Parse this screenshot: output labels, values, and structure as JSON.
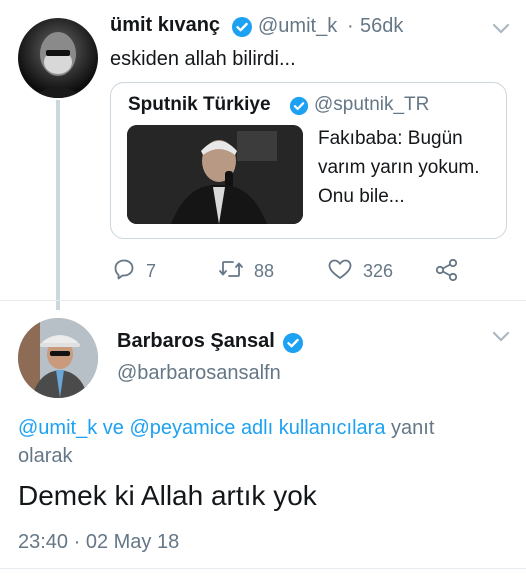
{
  "tweet": {
    "author_name": "ümit kıvanç",
    "author_handle": "@umit_k",
    "separator": "·",
    "time_ago": "56dk",
    "text": "eskiden allah bilirdi...",
    "quoted": {
      "author_name": "Sputnik Türkiye",
      "author_handle": "@sputnik_TR",
      "text": "Fakıbaba: Bugün varım yarın yokum. Onu bile..."
    },
    "actions": {
      "replies": "7",
      "retweets": "88",
      "likes": "326"
    }
  },
  "reply": {
    "author_name": "Barbaros Şansal",
    "author_handle": "@barbarosansalfn",
    "reply_to": {
      "mention1": "@umit_k",
      "connector": "ve",
      "mention2": "@peyamice",
      "mid_text": "adlı kullanıcılara",
      "tail_text": "yanıt olarak"
    },
    "text": "Demek ki Allah artık yok",
    "timestamp": "23:40 · 02 May 18"
  },
  "colors": {
    "accent": "#1da1f2",
    "muted": "#657786",
    "text": "#14171a",
    "border": "#ccd6dd"
  },
  "icons": [
    "verified-badge-icon",
    "chevron-down-icon",
    "reply-icon",
    "retweet-icon",
    "like-icon",
    "share-icon"
  ]
}
